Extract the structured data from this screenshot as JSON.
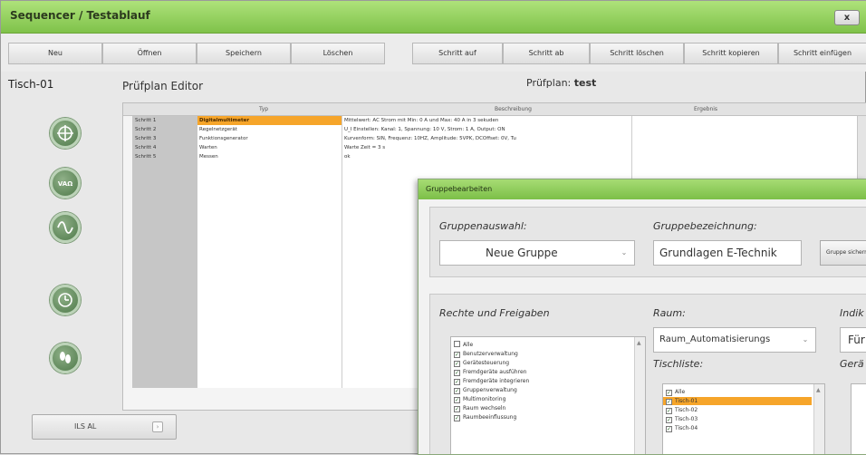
{
  "window": {
    "title": "Sequencer / Testablauf",
    "close_label": "x"
  },
  "toolbar": {
    "left": [
      "Neu",
      "Öffnen",
      "Speichern",
      "Löschen"
    ],
    "right": [
      "Schritt auf",
      "Schritt ab",
      "Schritt löschen",
      "Schritt kopieren",
      "Schritt einfügen"
    ]
  },
  "sidebar": {
    "device": "Tisch-01",
    "icons": [
      "crosshair-icon",
      "vao-icon",
      "sine-wave-icon",
      "clock-icon",
      "feet-icon"
    ]
  },
  "editor": {
    "title": "Prüfplan Editor",
    "plan_label": "Prüfplan:",
    "plan_name": "test",
    "columns": [
      "Typ",
      "Beschreibung",
      "Ergebnis"
    ],
    "rows": [
      {
        "step": "Schritt 1",
        "type": "Digitalmultimeter",
        "desc": "Mittelwert: AC Strom mit Min: 0 A und Max: 40 A in 3 sekuden",
        "result": ""
      },
      {
        "step": "Schritt 2",
        "type": "Regelnetzgerät",
        "desc": "U_I Einstellen: Kanal: 1, Spannung: 10 V, Strom: 1 A, Output: ON",
        "result": ""
      },
      {
        "step": "Schritt 3",
        "type": "Funktionsgenerator",
        "desc": "Kurvenform: SIN, Frequenz: 10HZ, Amplitude: 5VPK, DCOffset: 0V, Tu",
        "result": ""
      },
      {
        "step": "Schritt 4",
        "type": "Warten",
        "desc": "Warte Zeit = 3 s",
        "result": ""
      },
      {
        "step": "Schritt 5",
        "type": "Messen",
        "desc": "ok",
        "result": ""
      }
    ]
  },
  "bottom_button": {
    "label": "ILS AL",
    "arrow": "›"
  },
  "dialog": {
    "title": "Gruppebearbeiten",
    "group_select_label": "Gruppenauswahl:",
    "group_select_value": "Neue Gruppe",
    "group_name_label": "Gruppebezeichnung:",
    "group_name_value": "Grundlagen E-Technik",
    "group_button": "Gruppe sichern",
    "rights_label": "Rechte und Freigaben",
    "rights": [
      {
        "label": "Alle",
        "checked": false
      },
      {
        "label": "Benutzerverwaltung",
        "checked": true
      },
      {
        "label": "Gerätesteuerung",
        "checked": true
      },
      {
        "label": "Fremdgeräte ausführen",
        "checked": true
      },
      {
        "label": "Fremdgeräte integrieren",
        "checked": true
      },
      {
        "label": "Gruppenverwaltung",
        "checked": true
      },
      {
        "label": "Multimonitoring",
        "checked": true
      },
      {
        "label": "Raum wechseln",
        "checked": true
      },
      {
        "label": "Raumbeeinflussung",
        "checked": true
      }
    ],
    "room_label": "Raum:",
    "room_value": "Raum_Automatisierungs",
    "table_label": "Tischliste:",
    "tables": [
      {
        "label": "Alle",
        "checked": true,
        "highlight": false
      },
      {
        "label": "Tisch-01",
        "checked": true,
        "highlight": true
      },
      {
        "label": "Tisch-02",
        "checked": true,
        "highlight": false
      },
      {
        "label": "Tisch-03",
        "checked": true,
        "highlight": false
      },
      {
        "label": "Tisch-04",
        "checked": true,
        "highlight": false
      }
    ],
    "indicator_label": "Indik",
    "indicator_value": "Für",
    "devices_label": "Gerä"
  }
}
